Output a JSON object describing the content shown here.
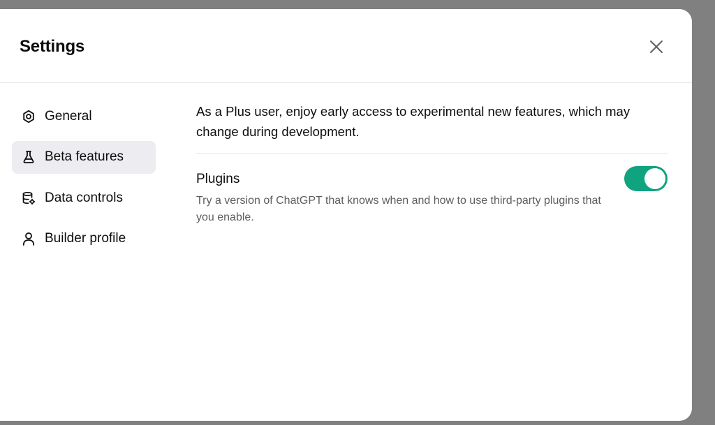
{
  "dialog": {
    "title": "Settings"
  },
  "sidebar": {
    "items": [
      {
        "label": "General",
        "icon": "gear-icon",
        "active": false
      },
      {
        "label": "Beta features",
        "icon": "flask-icon",
        "active": true
      },
      {
        "label": "Data controls",
        "icon": "database-gear-icon",
        "active": false
      },
      {
        "label": "Builder profile",
        "icon": "person-icon",
        "active": false
      }
    ]
  },
  "main": {
    "intro": "As a Plus user, enjoy early access to experimental new features, which may change during development.",
    "settings": [
      {
        "title": "Plugins",
        "description": "Try a version of ChatGPT that knows when and how to use third-party plugins that you enable.",
        "enabled": true
      }
    ]
  },
  "colors": {
    "toggle_on": "#10a37f",
    "active_nav_bg": "#ececf1",
    "overlay": "#808080"
  }
}
